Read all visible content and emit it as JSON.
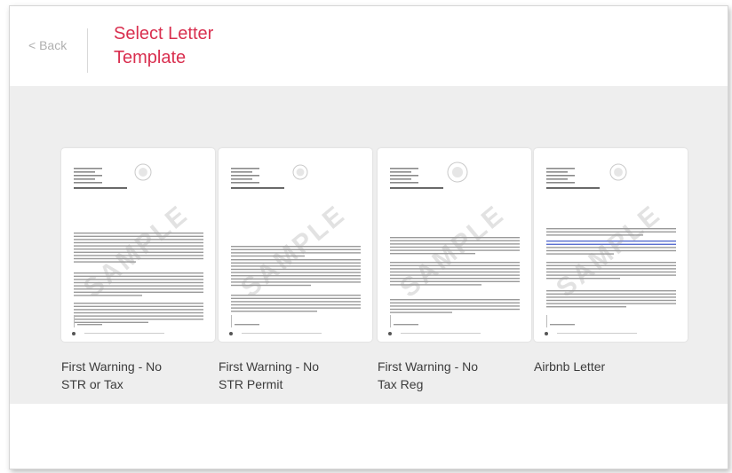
{
  "header": {
    "back_label": "< Back",
    "title_line1": "Select Letter",
    "title_line2": "Template"
  },
  "templates": [
    {
      "line1": "First Warning - No",
      "line2": "STR or Tax"
    },
    {
      "line1": "First Warning - No",
      "line2": "STR Permit"
    },
    {
      "line1": "First Warning - No",
      "line2": "Tax Reg"
    },
    {
      "line1": "Airbnb Letter",
      "line2": ""
    }
  ],
  "watermark": "SAMPLE",
  "colors": {
    "title": "#d92f4f",
    "stage_bg": "#eeeeee",
    "link_text": "#5a6fd0"
  }
}
